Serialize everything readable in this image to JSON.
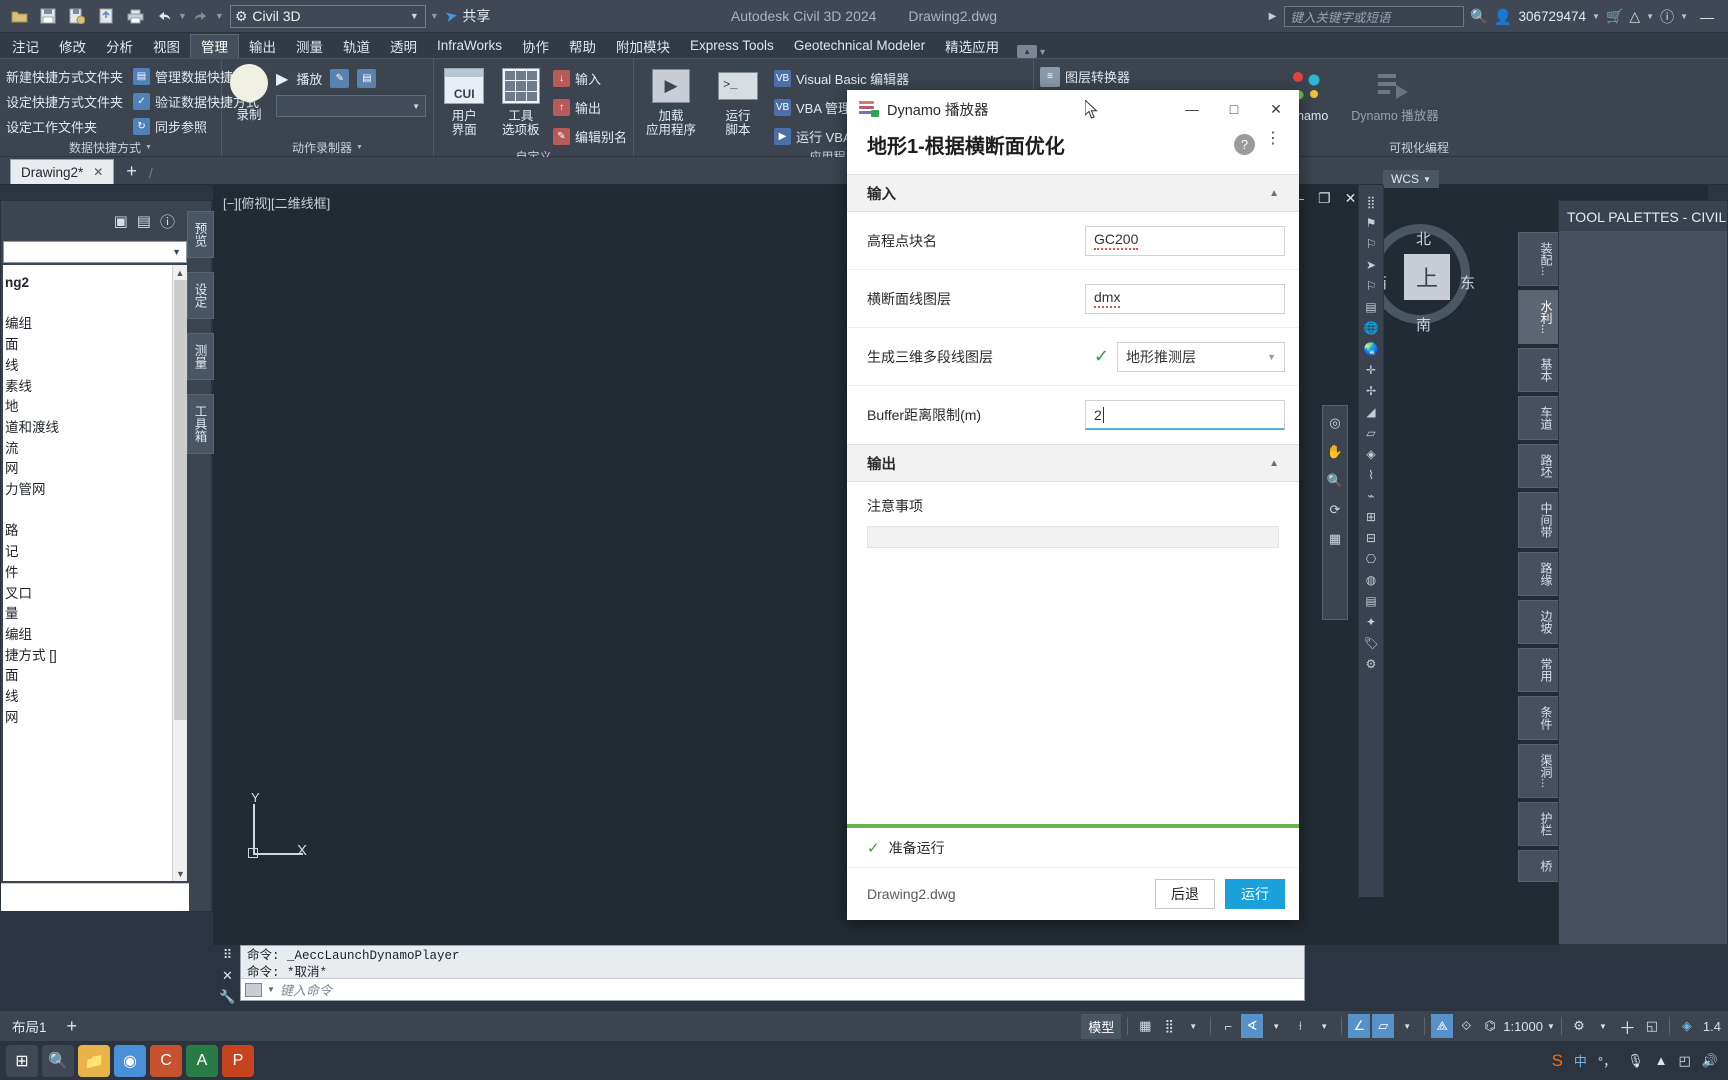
{
  "titlebar": {
    "quick_access": [
      {
        "name": "open-icon",
        "glyph": "Ὄ2"
      },
      {
        "name": "save-icon",
        "glyph": "▣"
      },
      {
        "name": "save-as-icon",
        "glyph": "▤"
      },
      {
        "name": "export-icon",
        "glyph": "▥"
      },
      {
        "name": "print-icon",
        "glyph": "⎙"
      },
      {
        "name": "undo-icon",
        "glyph": "↶"
      },
      {
        "name": "redo-icon",
        "glyph": "↷"
      }
    ],
    "workspace": "Civil 3D",
    "share_label": "共享",
    "app_title": "Autodesk Civil 3D 2024",
    "document_title": "Drawing2.dwg",
    "search_placeholder": "键入关键字或短语",
    "user_id": "306729474",
    "minimize": "—"
  },
  "ribbon_tabs": [
    {
      "label": "注记",
      "active": false
    },
    {
      "label": "修改",
      "active": false
    },
    {
      "label": "分析",
      "active": false
    },
    {
      "label": "视图",
      "active": false
    },
    {
      "label": "管理",
      "active": true
    },
    {
      "label": "输出",
      "active": false
    },
    {
      "label": "测量",
      "active": false
    },
    {
      "label": "轨道",
      "active": false
    },
    {
      "label": "透明",
      "active": false
    },
    {
      "label": "InfraWorks",
      "active": false
    },
    {
      "label": "协作",
      "active": false
    },
    {
      "label": "帮助",
      "active": false
    },
    {
      "label": "附加模块",
      "active": false
    },
    {
      "label": "Express Tools",
      "active": false
    },
    {
      "label": "Geotechnical Modeler",
      "active": false
    },
    {
      "label": "精选应用",
      "active": false
    }
  ],
  "ribbon_panels": [
    {
      "title": "数据快捷方式",
      "col1": [
        "新建快捷方式文件夹",
        "设定快捷方式文件夹",
        "设定工作文件夹"
      ],
      "col2": [
        "管理数据快捷方式",
        "验证数据快捷方式",
        "同步参照"
      ]
    },
    {
      "title": "动作录制器",
      "record_label": "录制",
      "play_label": "播放"
    },
    {
      "title": "自定义",
      "cui_label_1": "用户",
      "cui_label_2": "界面",
      "tool_label_1": "工具",
      "tool_label_2": "选项板",
      "items": [
        "输入",
        "输出",
        "编辑别名"
      ]
    },
    {
      "title": "应用程序",
      "load_label_1": "加载",
      "load_label_2": "应用程序",
      "run_label_1": "运行",
      "run_label_2": "脚本",
      "items": [
        "Visual Basic 编辑器",
        "VBA 管理器",
        "运行 VBA 宏"
      ]
    },
    {
      "title": "可视化编程",
      "items": [
        "图层转换器"
      ],
      "dynamo_label": "Dynamo",
      "dynamo_player_label": "Dynamo 播放器"
    }
  ],
  "doc_tabs": {
    "name": "Drawing2*",
    "close": "✕",
    "plus": "+"
  },
  "canvas": {
    "viewport_label": "[−][俯视][二维线框]",
    "ucs_y": "Y",
    "ucs_x": "X"
  },
  "toolspace": {
    "tree_items": [
      "ng2",
      "",
      "编组",
      "面",
      "线",
      "素线",
      "地",
      "道和渡线",
      "流",
      "网",
      "力管网",
      "",
      "路",
      "记",
      "件",
      "叉口",
      "量",
      "编组",
      "捷方式 []",
      "面",
      "线",
      "网"
    ],
    "vtabs": [
      "预览",
      "设定",
      "测量",
      "工具箱"
    ]
  },
  "viewcube": {
    "north": "北",
    "south": "南",
    "west": "西",
    "east": "东",
    "top": "上",
    "wcs": "WCS"
  },
  "tool_palettes": {
    "title": "TOOL PALETTES - CIVIL 公",
    "tabs": [
      "装配...",
      "水利...",
      "基本",
      "车道",
      "路坯",
      "中间带",
      "路缘",
      "边坡",
      "常用",
      "条件",
      "渠洞...",
      "护栏",
      "桥"
    ]
  },
  "command_line": {
    "history": [
      "命令: _AeccLaunchDynamoPlayer",
      "命令: *取消*"
    ],
    "placeholder": "键入命令"
  },
  "layout_bar": {
    "tab": "布局1",
    "plus": "+",
    "model": "模型",
    "scale": "1:1000",
    "annotation_scale": "1.4"
  },
  "dynamo_player": {
    "window_title": "Dynamo 播放器",
    "minimize": "—",
    "maximize": "□",
    "close": "✕",
    "graph_title": "地形1-根据横断面优化",
    "help_glyph": "?",
    "kebab_glyph": "⋮",
    "input_section": {
      "label": "输入",
      "collapse_chevron": "▲",
      "rows": [
        {
          "label": "高程点块名",
          "type": "text",
          "value": "GC200",
          "spellcheck_underline": true,
          "focused": false
        },
        {
          "label": "横断面线图层",
          "type": "text",
          "value": "dmx",
          "spellcheck_underline": true,
          "focused": false
        },
        {
          "label": "生成三维多段线图层",
          "type": "checkbox-select",
          "checked": true,
          "check_glyph": "✓",
          "value": "地形推测层",
          "dropdown_glyph": "▼"
        },
        {
          "label": "Buffer距离限制(m)",
          "type": "text",
          "value": "2",
          "focused": true
        }
      ]
    },
    "output_section": {
      "label": "输出",
      "collapse_chevron": "▲",
      "note_label": "注意事项",
      "note_value": ""
    },
    "status": {
      "check_glyph": "✓",
      "text": "准备运行"
    },
    "footer": {
      "file_name": "Drawing2.dwg",
      "back_label": "后退",
      "run_label": "运行"
    },
    "colors": {
      "primary": "#1aa0da",
      "progress": "#6bb346",
      "success": "#3f9c35",
      "focus": "#4fb3e8"
    }
  }
}
